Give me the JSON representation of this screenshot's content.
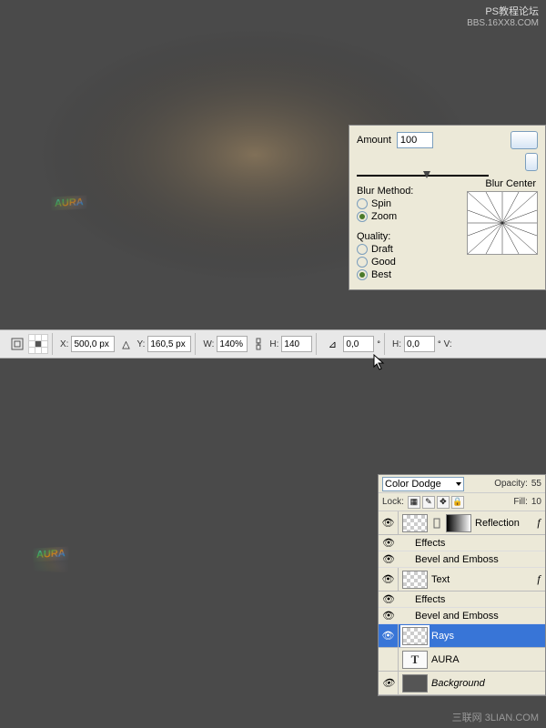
{
  "watermark_top": {
    "line1": "PS教程论坛",
    "line2": "BBS.16XX8.COM"
  },
  "watermark_bottom": "三联网 3LIAN.COM",
  "dialog": {
    "amount_label": "Amount",
    "amount_value": "100",
    "blur_method_label": "Blur Method:",
    "spin": "Spin",
    "zoom": "Zoom",
    "quality_label": "Quality:",
    "draft": "Draft",
    "good": "Good",
    "best": "Best",
    "blur_center_label": "Blur Center"
  },
  "toolbar": {
    "x_label": "X:",
    "x_value": "500,0 px",
    "y_label": "Y:",
    "y_value": "160,5 px",
    "w_label": "W:",
    "w_value": "140%",
    "h_label": "H:",
    "h_value": "140",
    "angle_value": "0,0",
    "h2_label": "H:",
    "h2_value": "0,0",
    "v_label": "V:"
  },
  "layers": {
    "blend_mode": "Color Dodge",
    "opacity_label": "Opacity:",
    "opacity_value": "55",
    "lock_label": "Lock:",
    "fill_label": "Fill:",
    "fill_value": "10",
    "effects_label": "Effects",
    "bevel_label": "Bevel and Emboss",
    "items": [
      {
        "name": "Reflection",
        "has_fx": true
      },
      {
        "name": "Text",
        "has_fx": true
      },
      {
        "name": "Rays",
        "selected": true
      },
      {
        "name": "AURA",
        "is_text": true
      },
      {
        "name": "Background",
        "italic": true,
        "solid": true
      }
    ]
  }
}
